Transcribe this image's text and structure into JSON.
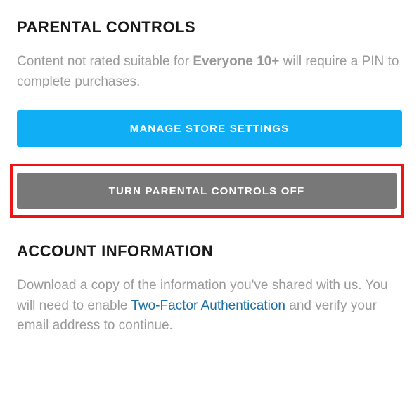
{
  "parental": {
    "title": "PARENTAL CONTROLS",
    "desc_before": "Content not rated suitable for ",
    "desc_bold": "Everyone 10+",
    "desc_after": " will require a PIN to complete purchases.",
    "manage_btn": "MANAGE STORE SETTINGS",
    "turnoff_btn": "TURN PARENTAL CONTROLS OFF"
  },
  "account": {
    "title": "ACCOUNT INFORMATION",
    "desc_part1": "Download a copy of the information you've shared with us. You will need to enable ",
    "link_text": "Two-Factor Authentication",
    "desc_part2": " and verify your email address to continue."
  }
}
